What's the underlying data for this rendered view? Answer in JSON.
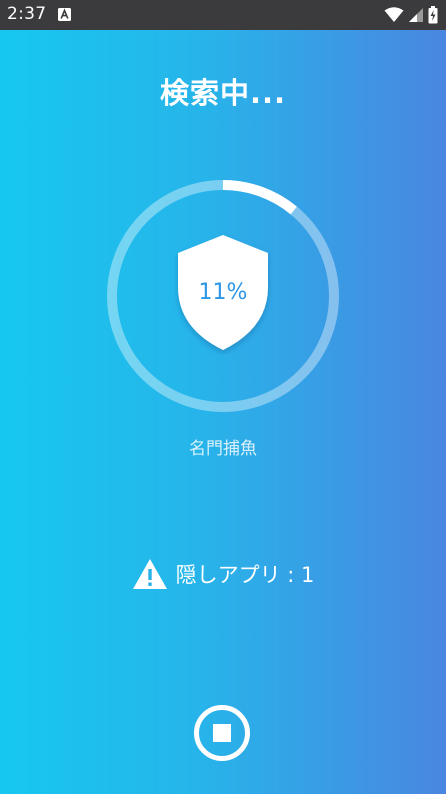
{
  "status_bar": {
    "time": "2:37",
    "notification_icon": "a-badge-icon",
    "icons": [
      "wifi-icon",
      "cellular-signal-icon",
      "battery-charging-icon"
    ]
  },
  "scan": {
    "title": "検索中...",
    "progress_percent_label": "11%",
    "progress_fraction": 0.11,
    "current_app": "名門捕魚"
  },
  "hidden_apps": {
    "label": "隠しアプリ : 1",
    "icon": "warning-icon"
  },
  "stop_button": {
    "icon": "stop-icon"
  },
  "colors": {
    "gradient_start": "#16C8EE",
    "gradient_end": "#4A86E0",
    "status_bar": "#3b3b3d",
    "percent_text": "#2d97e6",
    "ring_track": "rgba(255,255,255,0.38)",
    "ring_progress": "#ffffff"
  }
}
